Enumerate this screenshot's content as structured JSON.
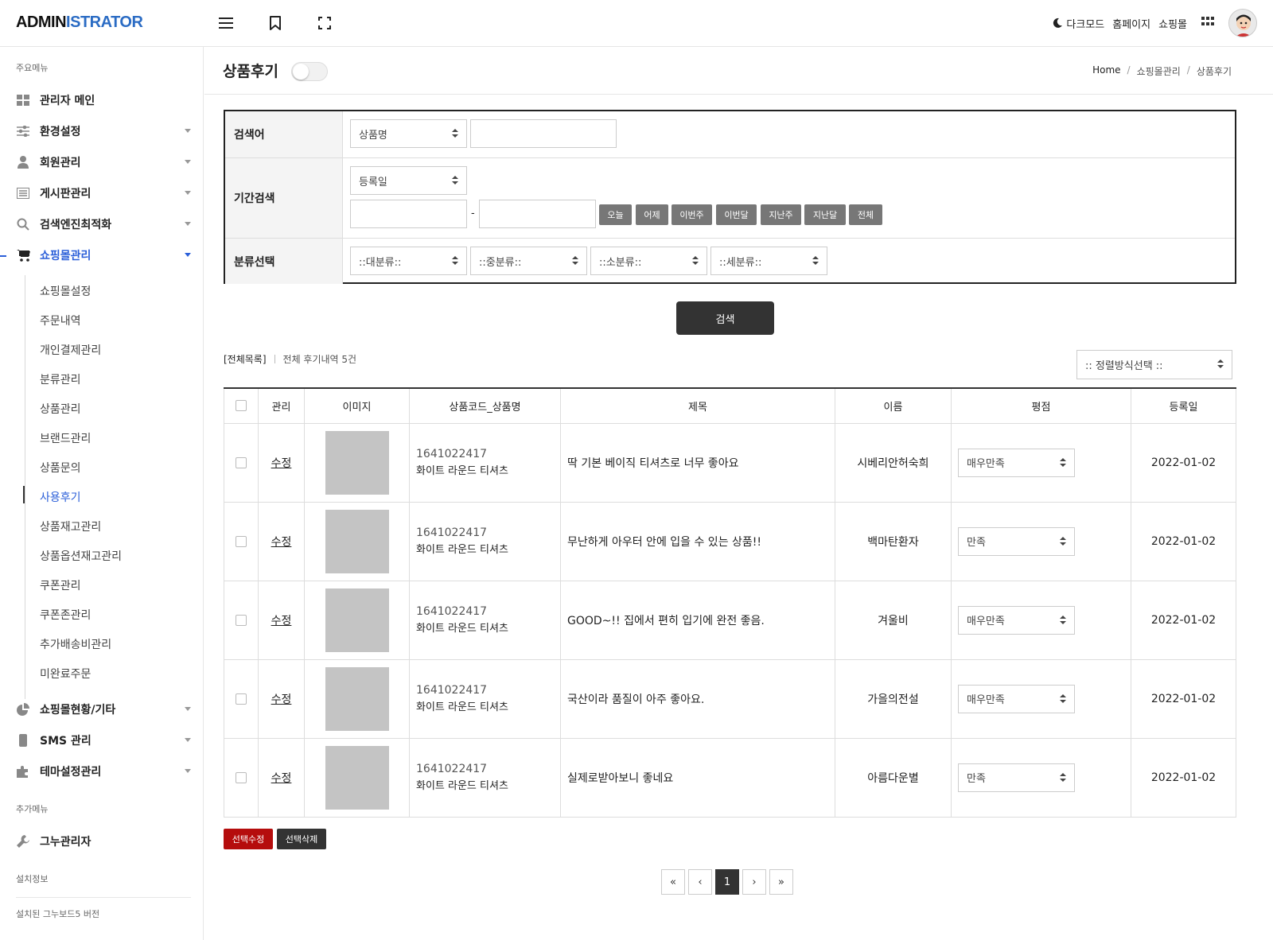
{
  "header": {
    "brand_part1": "ADMIN",
    "brand_part2": "ISTRATOR",
    "darkmode_label": "다크모드",
    "homepage_label": "홈페이지",
    "shop_label": "쇼핑몰",
    "icons": [
      "menu-icon",
      "bookmark-icon",
      "fullscreen-icon",
      "moon-icon",
      "apps-grid-icon"
    ]
  },
  "sidebar": {
    "main_label": "주요메뉴",
    "extra_label": "추가메뉴",
    "install_label": "설치정보",
    "install_version_label": "설치된 그누보드5 버전",
    "items": [
      {
        "label": "관리자 메인",
        "icon": "dashboard-icon"
      },
      {
        "label": "환경설정",
        "icon": "sliders-icon"
      },
      {
        "label": "회원관리",
        "icon": "user-icon"
      },
      {
        "label": "게시판관리",
        "icon": "list-icon"
      },
      {
        "label": "검색엔진최적화",
        "icon": "search-icon"
      },
      {
        "label": "쇼핑몰관리",
        "icon": "cart-icon"
      },
      {
        "label": "쇼핑몰현황/기타",
        "icon": "pie-chart-icon"
      },
      {
        "label": "SMS 관리",
        "icon": "phone-icon"
      },
      {
        "label": "테마설정관리",
        "icon": "puzzle-icon"
      },
      {
        "label": "그누관리자",
        "icon": "wrench-icon"
      }
    ],
    "sub_items": [
      "쇼핑몰설정",
      "주문내역",
      "개인결제관리",
      "분류관리",
      "상품관리",
      "브랜드관리",
      "상품문의",
      "사용후기",
      "상품재고관리",
      "상품옵션재고관리",
      "쿠폰관리",
      "쿠폰존관리",
      "추가배송비관리",
      "미완료주문"
    ],
    "active_sub": "사용후기"
  },
  "page": {
    "title": "상품후기",
    "breadcrumb": [
      "Home",
      "쇼핑몰관리",
      "상품후기"
    ],
    "accent_color": "#2b5fd9"
  },
  "search": {
    "keyword_label": "검색어",
    "keyword_select": "상품명",
    "keyword_value": "",
    "period_label": "기간검색",
    "period_select": "등록일",
    "period_sep": "-",
    "period_buttons": [
      "오늘",
      "어제",
      "이번주",
      "이번달",
      "지난주",
      "지난달",
      "전체"
    ],
    "category_label": "분류선택",
    "categories": [
      "::대분류::",
      "::중분류::",
      "::소분류::",
      "::세분류::"
    ],
    "submit_label": "검색"
  },
  "list": {
    "all_label": "[전체목록]",
    "count_label": "전체 후기내역 5건",
    "sort_select": ":: 정렬방식선택 ::",
    "columns": [
      "관리",
      "이미지",
      "상품코드_상품명",
      "제목",
      "이름",
      "평점",
      "등록일"
    ],
    "rows": [
      {
        "edit": "수정",
        "code": "1641022417",
        "name": "화이트 라운드 티셔츠",
        "subject": "딱 기본 베이직 티셔츠로 너무 좋아요",
        "author": "시베리안허숙희",
        "rating": "매우만족",
        "date": "2022-01-02"
      },
      {
        "edit": "수정",
        "code": "1641022417",
        "name": "화이트 라운드 티셔츠",
        "subject": "무난하게 아우터 안에 입을 수 있는 상품!!",
        "author": "백마탄환자",
        "rating": "만족",
        "date": "2022-01-02"
      },
      {
        "edit": "수정",
        "code": "1641022417",
        "name": "화이트 라운드 티셔츠",
        "subject": "GOOD~!! 집에서 편히 입기에 완전 좋음.",
        "author": "겨울비",
        "rating": "매우만족",
        "date": "2022-01-02"
      },
      {
        "edit": "수정",
        "code": "1641022417",
        "name": "화이트 라운드 티셔츠",
        "subject": "국산이라 품질이 아주 좋아요.",
        "author": "가을의전설",
        "rating": "매우만족",
        "date": "2022-01-02"
      },
      {
        "edit": "수정",
        "code": "1641022417",
        "name": "화이트 라운드 티셔츠",
        "subject": "실제로받아보니 좋네요",
        "author": "아름다운별",
        "rating": "만족",
        "date": "2022-01-02"
      }
    ],
    "bulk_edit_label": "선택수정",
    "bulk_delete_label": "선택삭제",
    "bulk_edit_color": "#b50d0d",
    "bulk_delete_color": "#333333"
  },
  "pagination": {
    "first": "«",
    "prev": "‹",
    "current": "1",
    "next": "›",
    "last": "»"
  }
}
